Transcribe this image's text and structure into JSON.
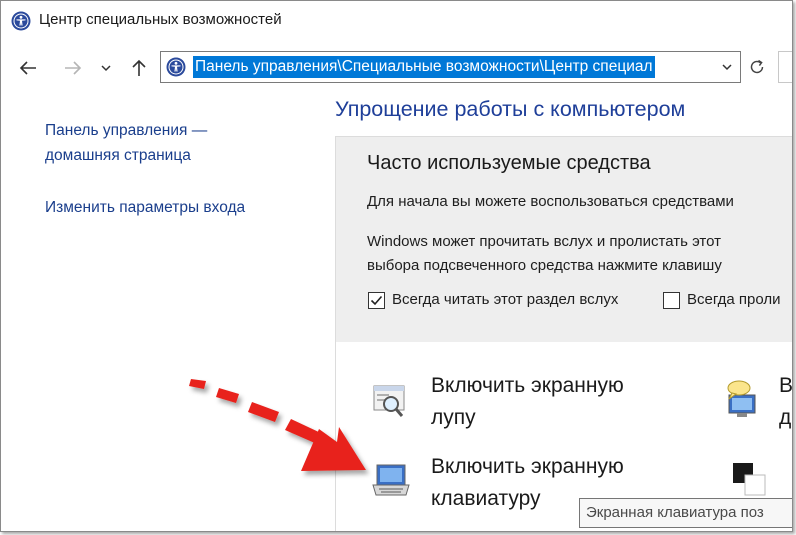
{
  "window": {
    "title": "Центр специальных возможностей"
  },
  "address_bar": {
    "path": "Панель управления\\Специальные возможности\\Центр специал"
  },
  "left_pane": {
    "links": [
      {
        "line1": "Панель управления —",
        "line2": "домашняя страница"
      },
      {
        "line1": "Изменить параметры входа"
      }
    ]
  },
  "main": {
    "title": "Упрощение работы с компьютером",
    "quick_tools": {
      "heading": "Часто используемые средства",
      "intro": "Для начала вы можете воспользоваться средствами",
      "windows_line1": "Windows может прочитать вслух и пролистать этот",
      "windows_line2": "выбора подсвеченного средства нажмите клавишу",
      "checkbox_read_aloud": {
        "label": "Всегда читать этот раздел вслух",
        "checked": true
      },
      "checkbox_scan": {
        "label": "Всегда проли",
        "checked": false
      }
    },
    "tools": [
      {
        "line1": "Включить экранную",
        "line2": "лупу",
        "icon": "magnifier-icon"
      },
      {
        "line1": "Включить экранную",
        "line2": "клавиатуру",
        "icon": "on-screen-keyboard-icon"
      },
      {
        "line1": "В",
        "line2": "д",
        "icon": "narrator-icon"
      },
      {
        "icon": "high-contrast-icon"
      }
    ],
    "tooltip": "Экранная клавиатура поз"
  },
  "colors": {
    "accent": "#0078d7",
    "link": "#1a3e8c",
    "heading": "#1f3f99",
    "panel": "#eeeeee",
    "annotation_arrow": "#e8231c"
  }
}
